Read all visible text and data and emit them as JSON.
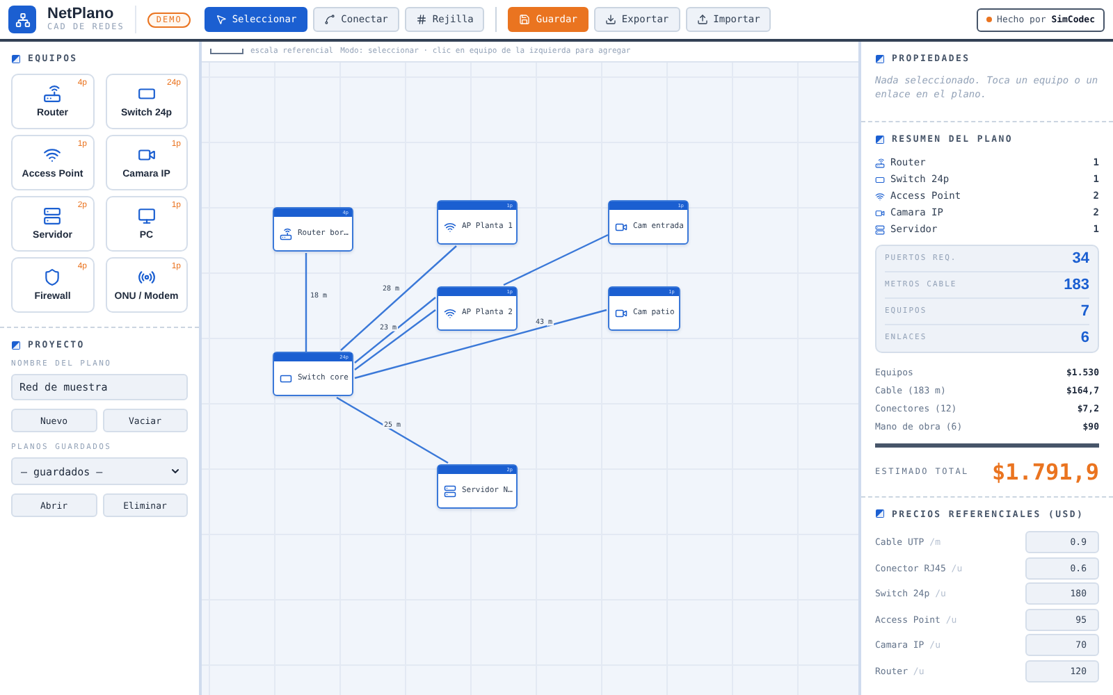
{
  "brand": {
    "name": "NetPlano",
    "subtitle": "CAD DE REDES",
    "badge": "DEMO"
  },
  "toolbar": {
    "tools": [
      {
        "label": "Seleccionar",
        "selected": true
      },
      {
        "label": "Conectar",
        "selected": false
      },
      {
        "label": "Rejilla",
        "selected": false
      }
    ],
    "actions": [
      {
        "label": "Guardar",
        "highlighted": true
      },
      {
        "label": "Exportar",
        "highlighted": false
      },
      {
        "label": "Importar",
        "highlighted": false
      }
    ]
  },
  "credit": {
    "text": "Hecho por ",
    "brand": "SimCodec"
  },
  "equipment": {
    "title": "EQUIPOS",
    "items": [
      {
        "kind": "router",
        "name": "Router",
        "ports": "4p"
      },
      {
        "kind": "switch",
        "name": "Switch 24p",
        "ports": "24p"
      },
      {
        "kind": "ap",
        "name": "Access Point",
        "ports": "1p"
      },
      {
        "kind": "camera",
        "name": "Camara IP",
        "ports": "1p"
      },
      {
        "kind": "server",
        "name": "Servidor",
        "ports": "2p"
      },
      {
        "kind": "pc",
        "name": "PC",
        "ports": "1p"
      },
      {
        "kind": "firewall",
        "name": "Firewall",
        "ports": "4p"
      },
      {
        "kind": "onu",
        "name": "ONU / Modem",
        "ports": "1p"
      }
    ]
  },
  "project": {
    "title": "PROYECTO",
    "name_label": "NOMBRE DEL PLANO",
    "name_value": "Red de muestra",
    "buttons": [
      "Nuevo",
      "Vaciar"
    ],
    "saved_label": "PLANOS GUARDADOS",
    "saved_select": "— guardados —",
    "saved_buttons": [
      "Abrir",
      "Eliminar"
    ]
  },
  "canvas": {
    "scale_label": "escala referencial",
    "hint": "Modo: seleccionar · clic en equipo de la izquierda para agregar",
    "nodes": [
      {
        "kind": "router",
        "label": "Router bor…",
        "ports": "4p"
      },
      {
        "kind": "ap",
        "label": "AP Planta 1",
        "ports": "1p"
      },
      {
        "kind": "camera",
        "label": "Cam entrada",
        "ports": "1p"
      },
      {
        "kind": "ap",
        "label": "AP Planta 2",
        "ports": "1p"
      },
      {
        "kind": "camera",
        "label": "Cam patio",
        "ports": "1p"
      },
      {
        "kind": "switch",
        "label": "Switch core",
        "ports": "24p"
      },
      {
        "kind": "server",
        "label": "Servidor N…",
        "ports": "2p"
      }
    ],
    "links": [
      {
        "length": "18 m"
      },
      {
        "length": "28 m"
      },
      {
        "length": "23 m"
      },
      {
        "kind": "routed"
      },
      {
        "length": "43 m"
      },
      {
        "length": "25 m"
      }
    ]
  },
  "properties": {
    "title": "PROPIEDADES",
    "empty_text": "Nada seleccionado. Toca un equipo o un enlace en el plano."
  },
  "summary": {
    "title": "RESUMEN DEL PLANO",
    "counts": [
      {
        "kind": "router",
        "name": "Router",
        "count": "1"
      },
      {
        "kind": "switch",
        "name": "Switch 24p",
        "count": "1"
      },
      {
        "kind": "ap",
        "name": "Access Point",
        "count": "2"
      },
      {
        "kind": "camera",
        "name": "Camara IP",
        "count": "2"
      },
      {
        "kind": "server",
        "name": "Servidor",
        "count": "1"
      }
    ],
    "stats": [
      {
        "label": "PUERTOS REQ.",
        "value": "34"
      },
      {
        "label": "METROS CABLE",
        "value": "183"
      },
      {
        "label": "EQUIPOS",
        "value": "7"
      },
      {
        "label": "ENLACES",
        "value": "6"
      }
    ],
    "costs": [
      {
        "label": "Equipos",
        "value": "$1.530"
      },
      {
        "label": "Cable (183 m)",
        "value": "$164,7"
      },
      {
        "label": "Conectores (12)",
        "value": "$7,2"
      },
      {
        "label": "Mano de obra (6)",
        "value": "$90"
      }
    ],
    "total_label": "ESTIMADO TOTAL",
    "total_value": "$1.791,9"
  },
  "prices": {
    "title": "PRECIOS REFERENCIALES (USD)",
    "items": [
      {
        "name": "Cable UTP",
        "unit": "/m",
        "value": "0.9"
      },
      {
        "name": "Conector RJ45",
        "unit": "/u",
        "value": "0.6"
      },
      {
        "name": "Switch 24p",
        "unit": "/u",
        "value": "180"
      },
      {
        "name": "Access Point",
        "unit": "/u",
        "value": "95"
      },
      {
        "name": "Camara IP",
        "unit": "/u",
        "value": "70"
      },
      {
        "name": "Router",
        "unit": "/u",
        "value": "120"
      }
    ]
  }
}
